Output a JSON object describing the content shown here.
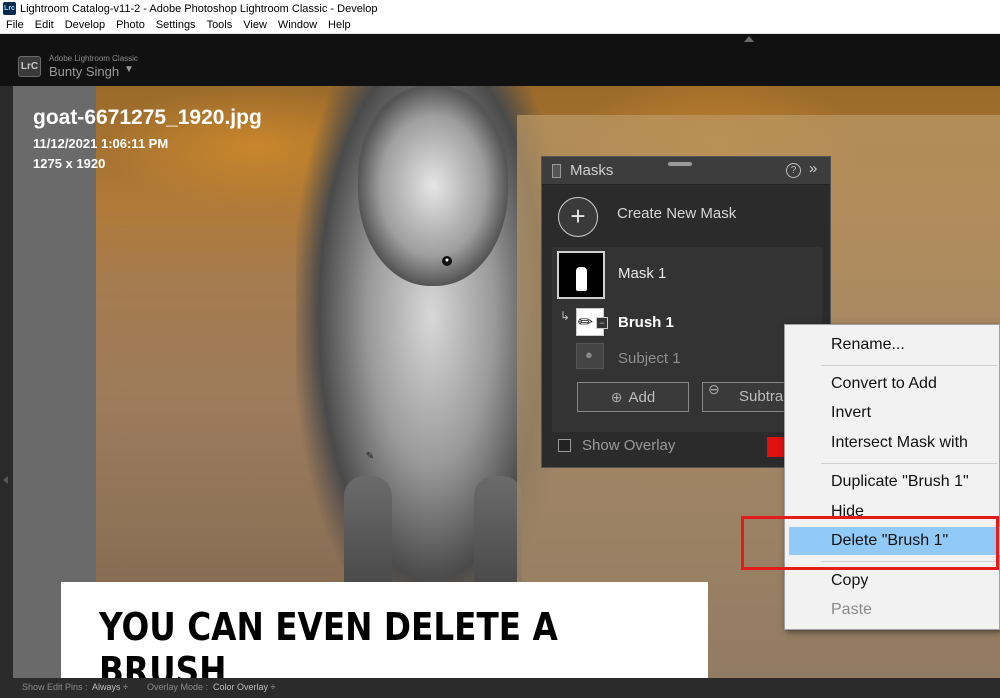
{
  "window": {
    "title": "Lightroom Catalog-v11-2 - Adobe Photoshop Lightroom Classic - Develop",
    "app_icon": "Lrc"
  },
  "menu": [
    "File",
    "Edit",
    "Develop",
    "Photo",
    "Settings",
    "Tools",
    "View",
    "Window",
    "Help"
  ],
  "identity": {
    "badge": "LrC",
    "product": "Adobe Lightroom Classic",
    "user": "Bunty Singh",
    "caret": "▼"
  },
  "photo_info": {
    "filename": "goat-6671275_1920.jpg",
    "datetime": "11/12/2021 1:06:11 PM",
    "dimensions": "1275 x 1920"
  },
  "masks_panel": {
    "title": "Masks",
    "help": "?",
    "expand": "»",
    "create_icon": "+",
    "create_label": "Create New Mask",
    "mask1_label": "Mask 1",
    "brush_label": "Brush 1",
    "brush_minus": "−",
    "subject_label": "Subject 1",
    "add_label": "Add",
    "subtract_label": "Subtract",
    "show_overlay_label": "Show Overlay",
    "overlay_color": "#e01010"
  },
  "context_menu": {
    "rename": "Rename...",
    "convert": "Convert to Add",
    "invert": "Invert",
    "intersect": "Intersect Mask with",
    "duplicate": "Duplicate \"Brush 1\"",
    "hide": "Hide",
    "delete": "Delete \"Brush 1\"",
    "copy": "Copy",
    "paste": "Paste",
    "highlight_color": "#91c9f7"
  },
  "caption": "YOU CAN EVEN DELETE A BRUSH",
  "toolbar": {
    "show_edit_pins_label": "Show Edit Pins :",
    "show_edit_pins_value": "Always ÷",
    "overlay_mode_label": "Overlay Mode :",
    "overlay_mode_value": "Color Overlay ÷"
  },
  "colors": {
    "annotation_red": "#e31b1b",
    "panel_bg": "#2b2b2b"
  }
}
